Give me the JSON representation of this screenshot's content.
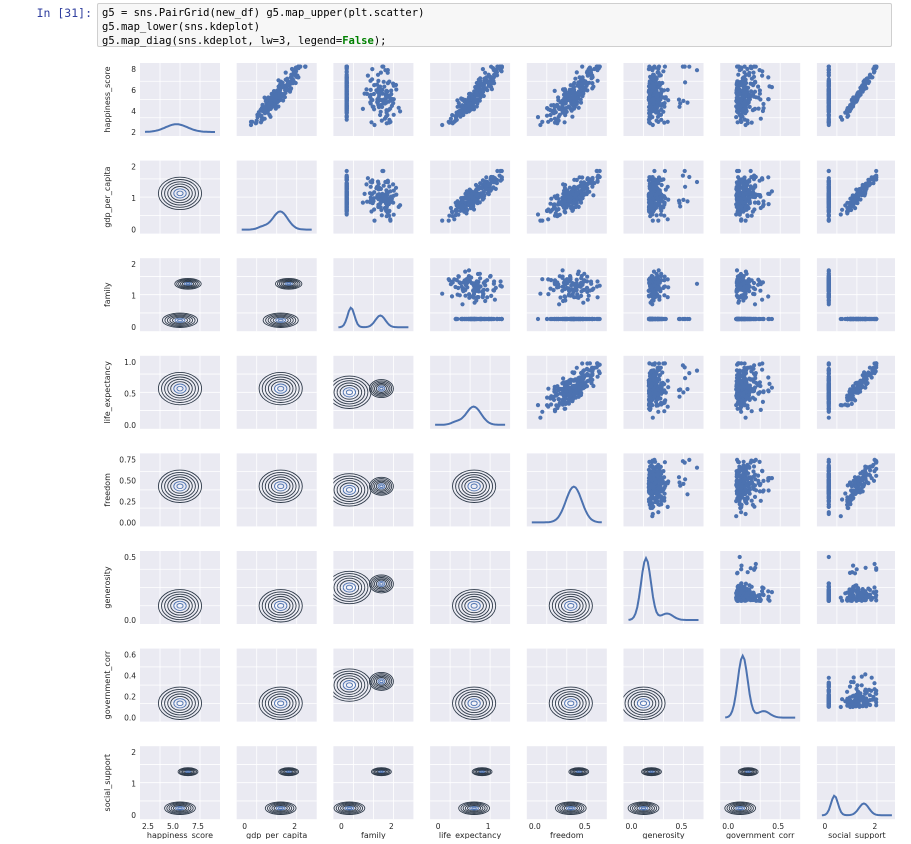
{
  "cell": {
    "prompt": "In [31]:",
    "lines": [
      {
        "pre": "g5 = sns.PairGrid(new_df) g5.map_upper(plt.scatter)",
        "kw": "",
        "post": ""
      },
      {
        "pre": "g5.map_lower(sns.kdeplot)",
        "kw": "",
        "post": ""
      },
      {
        "pre": "g5.map_diag(sns.kdeplot, lw=3, legend=",
        "kw": "False",
        "post": ");"
      }
    ]
  },
  "colors": {
    "panel_bg": "#eaeaf2",
    "grid": "#ffffff",
    "scatter": "#4c72b0",
    "kde_line": "#2f3b4a",
    "axis_text": "#262626"
  },
  "chart_data": {
    "type": "pair-grid",
    "variables": [
      "happiness_score",
      "gdp_per_capita",
      "family",
      "life_expectancy",
      "freedom",
      "generosity",
      "government_corr",
      "social_support"
    ],
    "upper": "scatter",
    "lower": "kde-contours",
    "diag": "kde",
    "ranges": {
      "happiness_score": [
        2,
        8
      ],
      "gdp_per_capita": [
        -0.5,
        2.3
      ],
      "family": [
        -0.4,
        2.0
      ],
      "life_expectancy": [
        -0.2,
        1.25
      ],
      "freedom": [
        -0.1,
        0.8
      ],
      "generosity": [
        -0.1,
        0.85
      ],
      "government_corr": [
        -0.05,
        0.6
      ],
      "social_support": [
        -0.4,
        2.3
      ]
    },
    "yticks": [
      [
        "2",
        "4",
        "6",
        "8"
      ],
      [
        "0",
        "1",
        "2"
      ],
      [
        "0",
        "1",
        "2"
      ],
      [
        "0.0",
        "0.5",
        "1.0"
      ],
      [
        "0.00",
        "0.25",
        "0.50",
        "0.75"
      ],
      [
        "0.0",
        "0.5"
      ],
      [
        "0.0",
        "0.2",
        "0.4",
        "0.6"
      ],
      [
        "0",
        "1",
        "2"
      ]
    ],
    "xticks": [
      [
        "2.5",
        "5.0",
        "7.5"
      ],
      [
        "0",
        "2"
      ],
      [
        "0",
        "2"
      ],
      [
        "0",
        "1"
      ],
      [
        "0.0",
        "0.5"
      ],
      [
        "0.0",
        "0.5"
      ],
      [
        "0.0",
        "0.5"
      ],
      [
        "0",
        "2"
      ]
    ]
  }
}
